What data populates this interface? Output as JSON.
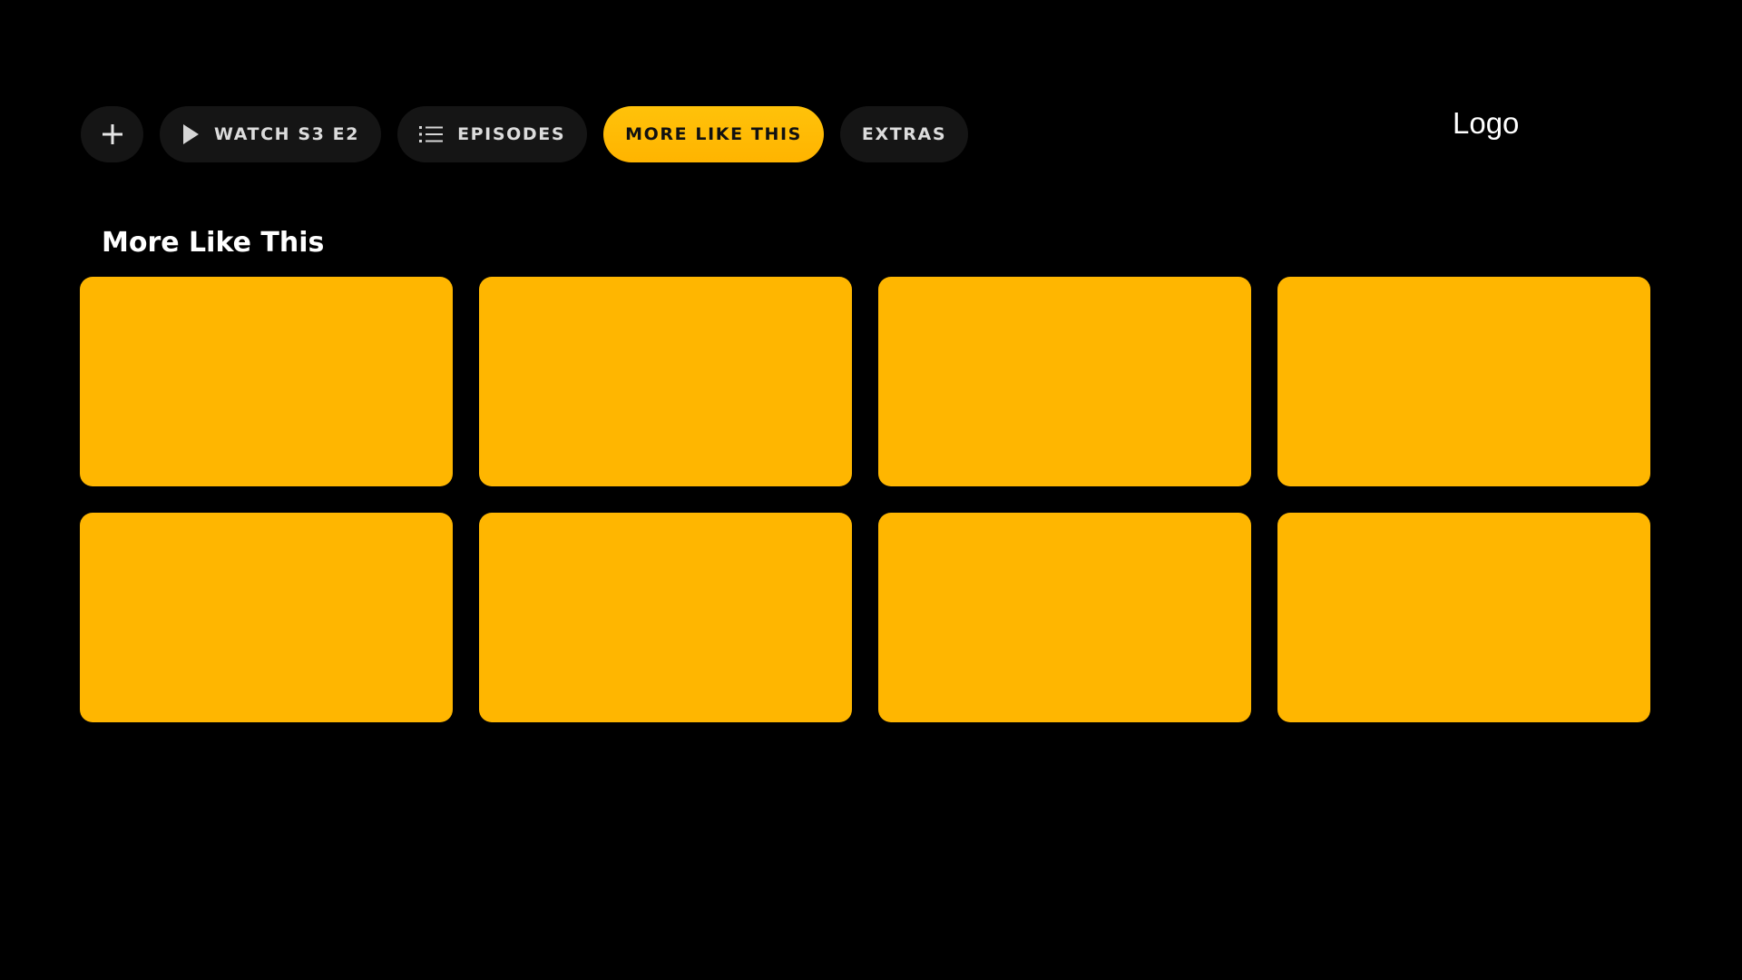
{
  "action_bar": {
    "add_icon": "plus-icon",
    "watch": {
      "label": "WATCH S3 E2",
      "icon": "play-icon"
    },
    "episodes": {
      "label": "EPISODES",
      "icon": "list-icon"
    },
    "more_like_this": {
      "label": "MORE LIKE THIS",
      "selected": true
    },
    "extras": {
      "label": "EXTRAS"
    }
  },
  "logo": {
    "text": "Logo"
  },
  "section": {
    "title": "More Like This",
    "tile_count": 8
  },
  "colors": {
    "background": "#000000",
    "pill_background": "#151515",
    "accent": "#ffb600",
    "tile": "#ffb600",
    "text_primary": "#ffffff",
    "text_pill": "#dcdcdc"
  }
}
